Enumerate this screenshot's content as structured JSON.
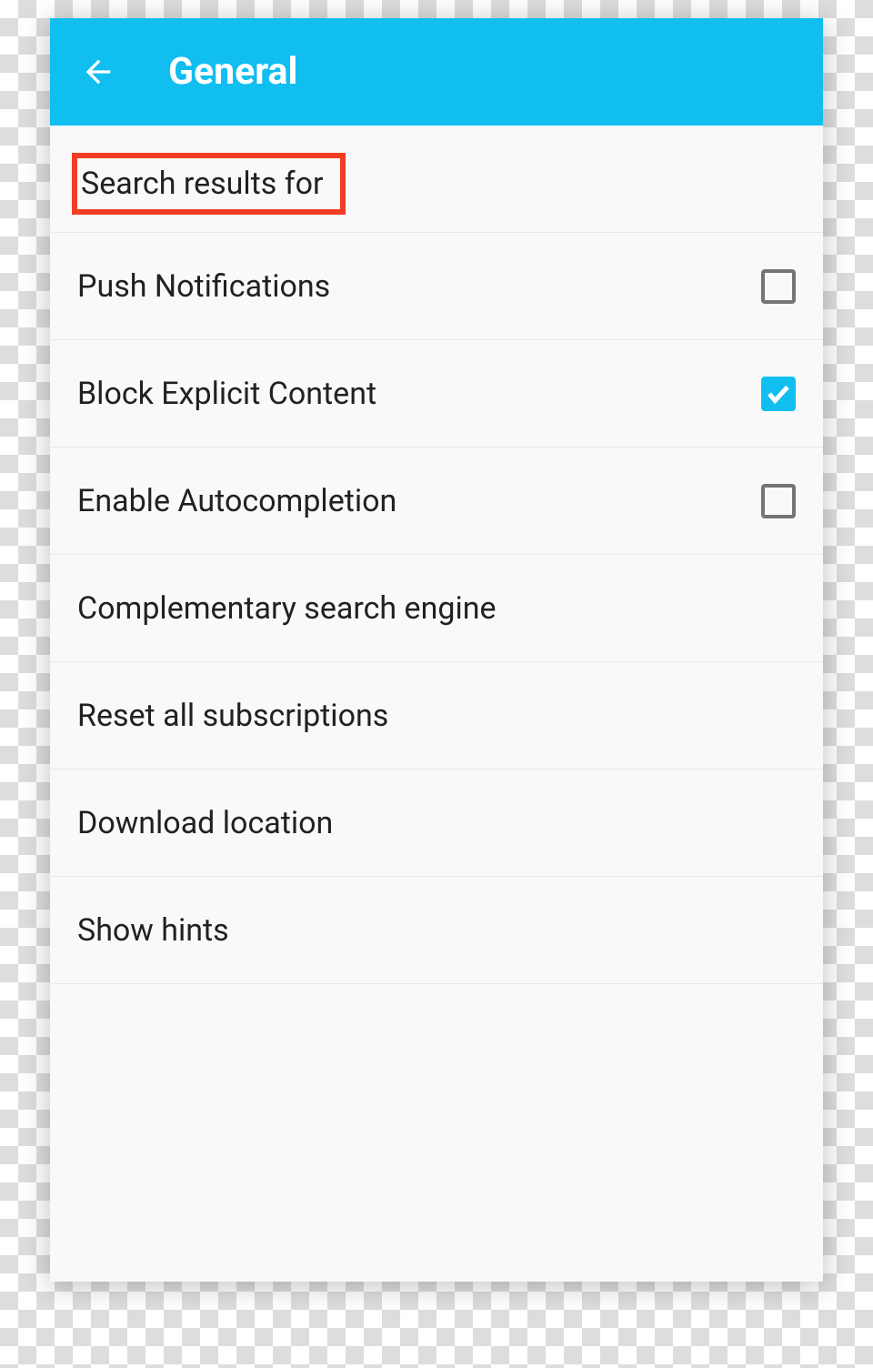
{
  "appBar": {
    "title": "General"
  },
  "rows": [
    {
      "label": "Search results for",
      "highlighted": true,
      "hasCheckbox": false
    },
    {
      "label": "Push Notifications",
      "highlighted": false,
      "hasCheckbox": true,
      "checked": false
    },
    {
      "label": "Block Explicit Content",
      "highlighted": false,
      "hasCheckbox": true,
      "checked": true
    },
    {
      "label": "Enable Autocompletion",
      "highlighted": false,
      "hasCheckbox": true,
      "checked": false
    },
    {
      "label": "Complementary search engine",
      "highlighted": false,
      "hasCheckbox": false
    },
    {
      "label": "Reset all subscriptions",
      "highlighted": false,
      "hasCheckbox": false
    },
    {
      "label": "Download location",
      "highlighted": false,
      "hasCheckbox": false
    },
    {
      "label": "Show hints",
      "highlighted": false,
      "hasCheckbox": false
    }
  ]
}
